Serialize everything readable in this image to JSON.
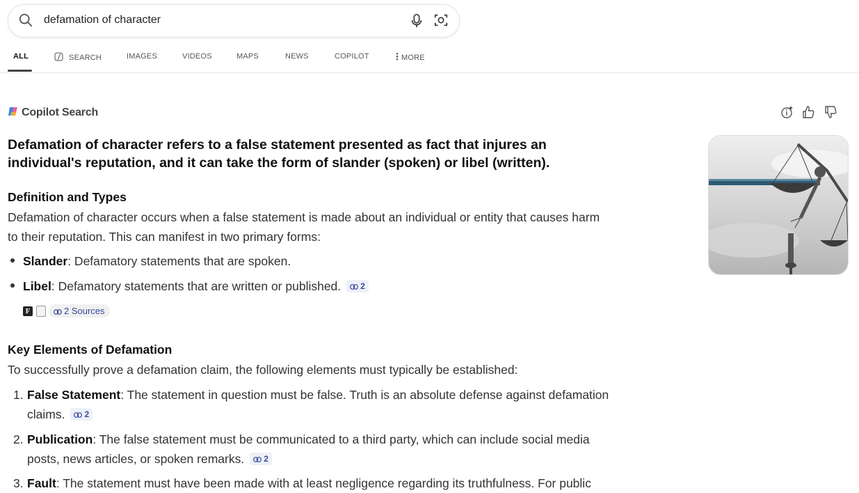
{
  "search": {
    "query": "defamation of character"
  },
  "tabs": [
    {
      "label": "ALL"
    },
    {
      "label": "SEARCH"
    },
    {
      "label": "IMAGES"
    },
    {
      "label": "VIDEOS"
    },
    {
      "label": "MAPS"
    },
    {
      "label": "NEWS"
    },
    {
      "label": "COPILOT"
    },
    {
      "label": "MORE"
    }
  ],
  "brand": "Copilot Search",
  "answer": {
    "headline": "Defamation of character refers to a false statement presented as fact that injures an individual's reputation, and it can take the form of slander (spoken) or libel (written).",
    "section1": {
      "title": "Definition and Types",
      "intro": "Defamation of character occurs when a false statement is made about an individual or entity that causes harm to their reputation. This can manifest in two primary forms:",
      "bullets": [
        {
          "term": "Slander",
          "text": ": Defamatory statements that are spoken."
        },
        {
          "term": "Libel",
          "text": ": Defamatory statements that are written or published.",
          "cite": "2"
        }
      ],
      "sources": "2 Sources"
    },
    "section2": {
      "title": "Key Elements of Defamation",
      "intro": "To successfully prove a defamation claim, the following elements must typically be established:",
      "items": [
        {
          "n": "1.",
          "term": "False Statement",
          "text": ": The statement in question must be false. Truth is an absolute defense against defamation claims.",
          "cite": "2"
        },
        {
          "n": "2.",
          "term": "Publication",
          "text": ": The false statement must be communicated to a third party, which can include social media posts, news articles, or spoken remarks.",
          "cite": "2"
        },
        {
          "n": "3.",
          "term": "Fault",
          "text": ": The statement must have been made with at least negligence regarding its truthfulness. For public"
        }
      ]
    }
  },
  "colors": {
    "accent_link": "#3a4a9a",
    "text": "#333333",
    "tab_active": "#111111"
  }
}
